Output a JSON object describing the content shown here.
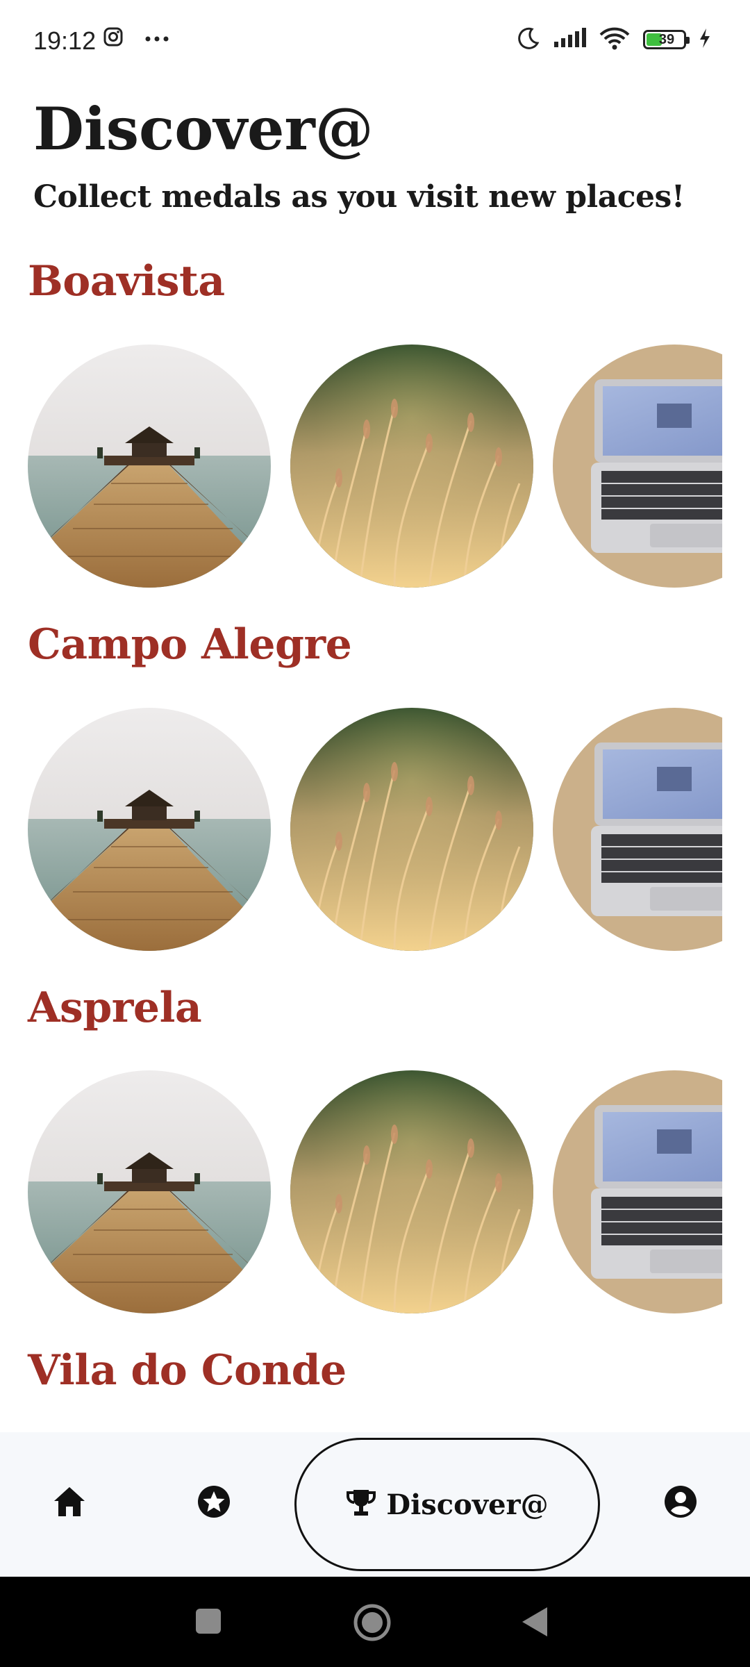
{
  "status_bar": {
    "time": "19:12",
    "battery_level": "39",
    "icons": [
      "instagram-icon",
      "more-dots-icon",
      "moon-icon",
      "signal-icon",
      "wifi-icon",
      "battery-icon",
      "charging-icon"
    ]
  },
  "header": {
    "title": "Discover@",
    "subtitle": "Collect medals as you visit new places!"
  },
  "sections": [
    {
      "title": "Boavista",
      "medals": [
        "pier-photo",
        "grass-photo",
        "laptop-photo"
      ]
    },
    {
      "title": "Campo Alegre",
      "medals": [
        "pier-photo",
        "grass-photo",
        "laptop-photo"
      ]
    },
    {
      "title": "Asprela",
      "medals": [
        "pier-photo",
        "grass-photo",
        "laptop-photo"
      ]
    },
    {
      "title": "Vila do Conde",
      "medals": []
    }
  ],
  "bottom_nav": {
    "items": [
      {
        "icon": "home-icon"
      },
      {
        "icon": "star-badge-icon"
      },
      {
        "icon": "trophy-icon",
        "label": "Discover@",
        "active": true
      },
      {
        "icon": "account-icon"
      }
    ]
  },
  "colors": {
    "section_title": "#9e2f25",
    "text": "#1a1a1a",
    "nav_background": "#f6f8fb"
  }
}
